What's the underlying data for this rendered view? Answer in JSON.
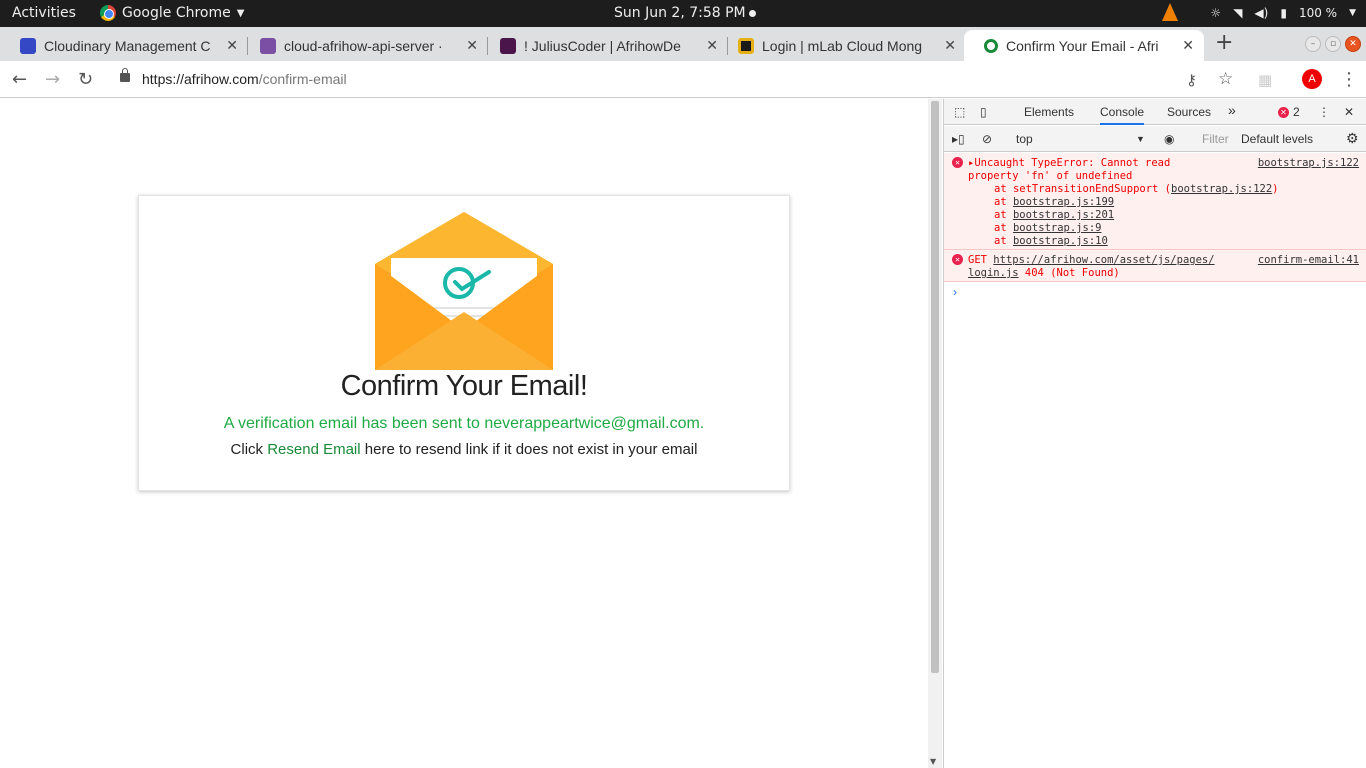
{
  "topbar": {
    "activities": "Activities",
    "app_name": "Google Chrome",
    "clock": "Sun Jun  2,  7:58 PM",
    "battery": "100 %"
  },
  "tabs": [
    {
      "title": "Cloudinary Management C",
      "favicon_color": "#3448c5"
    },
    {
      "title": "cloud-afrihow-api-server ·",
      "favicon_color": "#7b4fa3"
    },
    {
      "title": "! JuliusCoder | AfrihowDe",
      "favicon_color": "#4a154b"
    },
    {
      "title": "Login | mLab Cloud Mong",
      "favicon_color": "#1a1a1a"
    },
    {
      "title": "Confirm Your Email - Afri",
      "favicon_color": "#ffffff"
    }
  ],
  "address": {
    "host": "https://afrihow.com",
    "path": "/confirm-email",
    "avatar": "A"
  },
  "card": {
    "title": "Confirm Your Email!",
    "message": "A verification email has been sent to neverappeartwice@gmail.com.",
    "line_prefix": "Click",
    "link": "Resend Email",
    "line_suffix": "here to resend link if it does not exist in your email"
  },
  "devtools": {
    "tabs": [
      "Elements",
      "Console",
      "Sources"
    ],
    "more": "»",
    "error_count": "2",
    "context": "top",
    "filter_placeholder": "Filter",
    "levels": "Default levels",
    "errors": [
      {
        "source": "bootstrap.js:122",
        "lines": [
          "Uncaught TypeError: Cannot read",
          "property 'fn' of undefined"
        ],
        "stack": [
          {
            "prefix": "at setTransitionEndSupport (",
            "link": "bootstrap.js:122",
            "suffix": ")"
          },
          {
            "prefix": "at ",
            "link": "bootstrap.js:199",
            "suffix": ""
          },
          {
            "prefix": "at ",
            "link": "bootstrap.js:201",
            "suffix": ""
          },
          {
            "prefix": "at ",
            "link": "bootstrap.js:9",
            "suffix": ""
          },
          {
            "prefix": "at ",
            "link": "bootstrap.js:10",
            "suffix": ""
          }
        ]
      },
      {
        "source": "confirm-email:41",
        "get": "GET",
        "url1": "https://afrihow.com/asset/js/pages/",
        "url2": "login.js",
        "status": "404 (Not Found)"
      }
    ],
    "prompt": "›"
  }
}
